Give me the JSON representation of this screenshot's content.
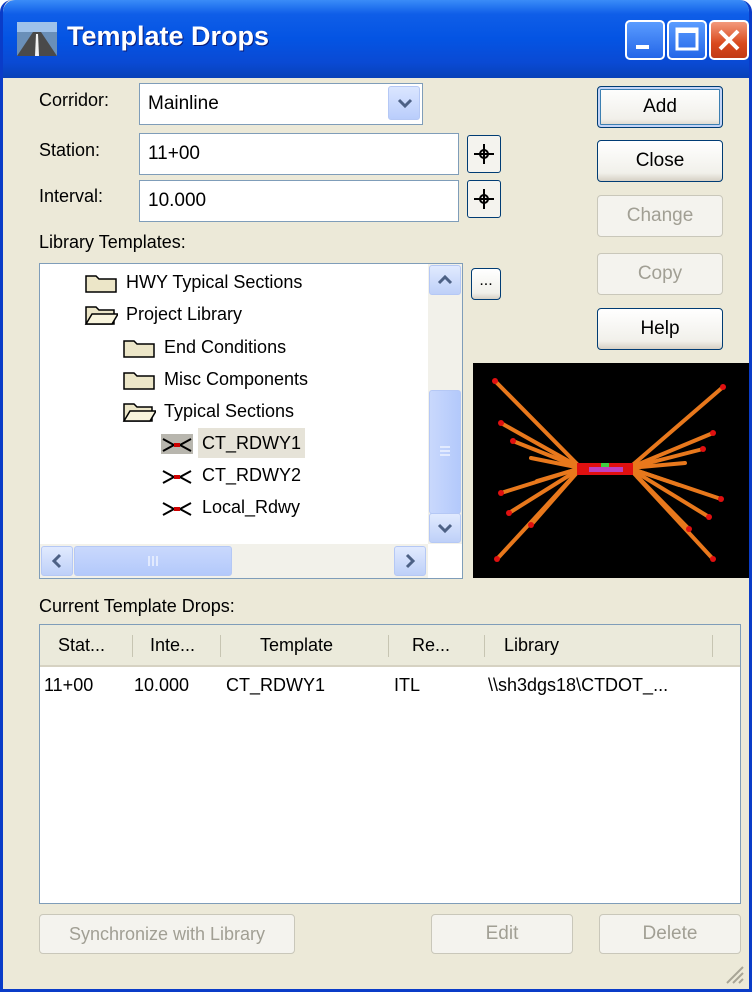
{
  "window": {
    "title": "Template Drops"
  },
  "form": {
    "corridor_label": "Corridor:",
    "corridor_value": "Mainline",
    "station_label": "Station:",
    "station_value": "11+00",
    "interval_label": "Interval:",
    "interval_value": "10.000"
  },
  "buttons": {
    "add": "Add",
    "close": "Close",
    "change": "Change",
    "copy": "Copy",
    "help": "Help",
    "browse": "...",
    "synchronize": "Synchronize with Library",
    "edit": "Edit",
    "delete": "Delete"
  },
  "library": {
    "label": "Library Templates:",
    "tree": [
      {
        "label": "HWY Typical Sections",
        "icon": "folder-closed-icon"
      },
      {
        "label": "Project Library",
        "icon": "folder-open-icon"
      },
      {
        "label": "End Conditions",
        "icon": "folder-closed-icon"
      },
      {
        "label": "Misc Components",
        "icon": "folder-closed-icon"
      },
      {
        "label": "Typical Sections",
        "icon": "folder-open-icon"
      },
      {
        "label": "CT_RDWY1",
        "icon": "template-icon",
        "selected": true
      },
      {
        "label": "CT_RDWY2",
        "icon": "template-icon"
      },
      {
        "label": "Local_Rdwy",
        "icon": "template-icon"
      }
    ]
  },
  "drops": {
    "label": "Current Template Drops:",
    "columns": [
      "Stat...",
      "Inte...",
      "Template",
      "Re...",
      "Library"
    ],
    "rows": [
      [
        "11+00",
        "10.000",
        "CT_RDWY1",
        "ITL",
        "\\\\sh3dgs18\\CTDOT_..."
      ]
    ]
  },
  "colors": {
    "title_bar": "#0454e3",
    "dialog_bg": "#ece9d8",
    "preview_bg": "#000000",
    "preview_lines": "#e8781c"
  }
}
